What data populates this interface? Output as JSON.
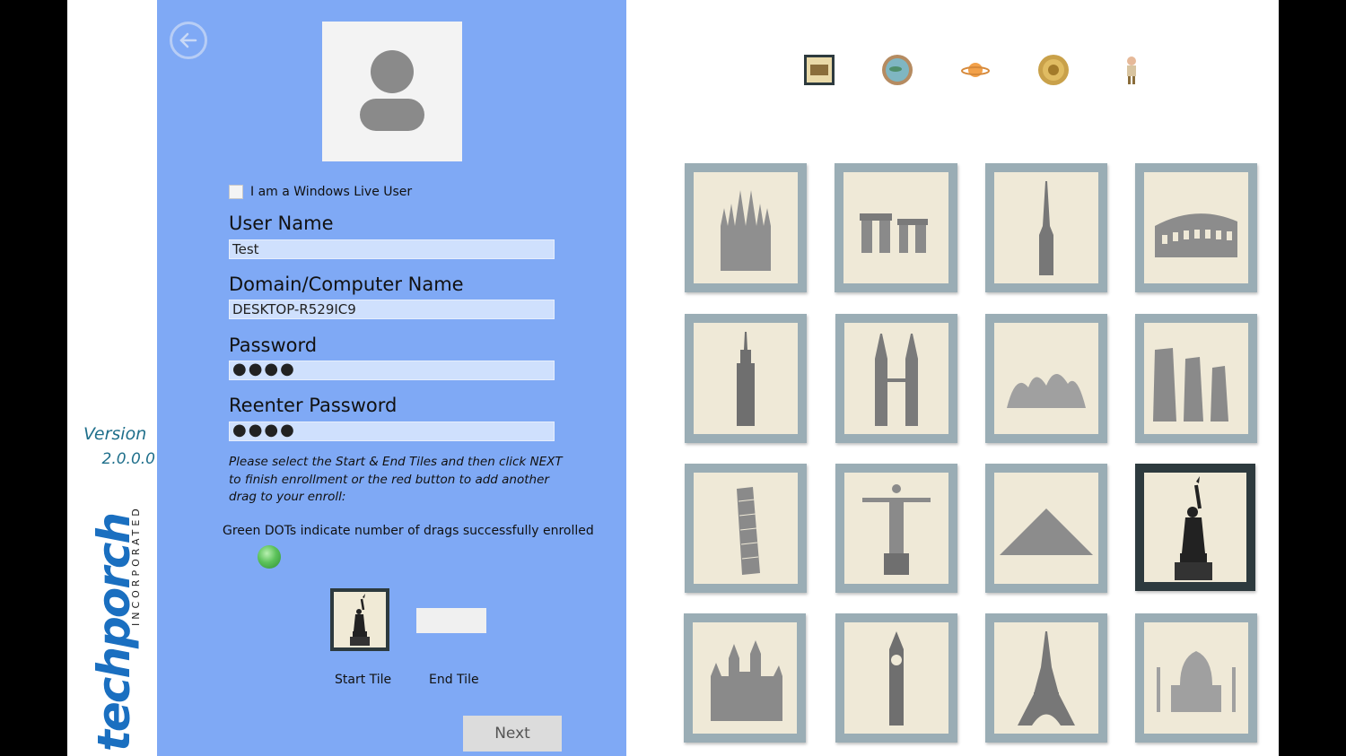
{
  "brand": {
    "version_label": "Version",
    "version_number": "2.0.0.0",
    "logo_main": "techporch",
    "logo_sub": "INCORPORATED"
  },
  "form": {
    "windows_live_label": "I am a Windows Live User",
    "windows_live_checked": false,
    "username_label": "User Name",
    "username_value": "Test",
    "domain_label": "Domain/Computer Name",
    "domain_value": "DESKTOP-R529IC9",
    "password_label": "Password",
    "password_value": "●●●●",
    "reenter_label": "Reenter Password",
    "reenter_value": "●●●●",
    "instructions": "Please select the Start & End Tiles and then click NEXT to finish enrollment or the red button to add another drag to your enroll:",
    "green_info": "Green DOTs indicate number of drags successfully enrolled",
    "enrolled_drag_count": 1,
    "start_tile_label": "Start Tile",
    "end_tile_label": "End Tile",
    "start_tile_icon": "statue-of-liberty-icon",
    "next_label": "Next"
  },
  "category_tabs": [
    {
      "name": "tab-comic-icon",
      "selected": true
    },
    {
      "name": "tab-globe-icon",
      "selected": false
    },
    {
      "name": "tab-planet-icon",
      "selected": false
    },
    {
      "name": "tab-coin-icon",
      "selected": false
    },
    {
      "name": "tab-character-icon",
      "selected": false
    }
  ],
  "tiles": [
    {
      "name": "sagrada-familia-tile",
      "icon": "cathedral-icon",
      "selected": false
    },
    {
      "name": "stonehenge-tile",
      "icon": "stonehenge-icon",
      "selected": false
    },
    {
      "name": "burj-khalifa-tile",
      "icon": "skyscraper-spire-icon",
      "selected": false
    },
    {
      "name": "colosseum-tile",
      "icon": "colosseum-icon",
      "selected": false
    },
    {
      "name": "empire-state-tile",
      "icon": "empire-state-icon",
      "selected": false
    },
    {
      "name": "petronas-towers-tile",
      "icon": "twin-towers-icon",
      "selected": false
    },
    {
      "name": "sydney-opera-house-tile",
      "icon": "opera-house-icon",
      "selected": false
    },
    {
      "name": "moai-tile",
      "icon": "moai-icon",
      "selected": false
    },
    {
      "name": "leaning-tower-tile",
      "icon": "leaning-tower-icon",
      "selected": false
    },
    {
      "name": "christ-redeemer-tile",
      "icon": "christ-statue-icon",
      "selected": false
    },
    {
      "name": "pyramid-tile",
      "icon": "pyramid-icon",
      "selected": false
    },
    {
      "name": "statue-of-liberty-tile",
      "icon": "statue-of-liberty-icon",
      "selected": true
    },
    {
      "name": "neuschwanstein-tile",
      "icon": "castle-icon",
      "selected": false
    },
    {
      "name": "big-ben-tile",
      "icon": "clock-tower-icon",
      "selected": false
    },
    {
      "name": "eiffel-tower-tile",
      "icon": "eiffel-tower-icon",
      "selected": false
    },
    {
      "name": "taj-mahal-tile",
      "icon": "taj-mahal-icon",
      "selected": false
    }
  ],
  "colors": {
    "panel_bg": "#7fa9f5",
    "field_bg": "#cfe0fd",
    "tile_frame": "#9aadb5",
    "tile_selected_frame": "#2d3a3e",
    "version_text": "#1f6f8b",
    "logo_blue": "#1a6fc0",
    "enrolled_dot": "#5cc25a"
  }
}
